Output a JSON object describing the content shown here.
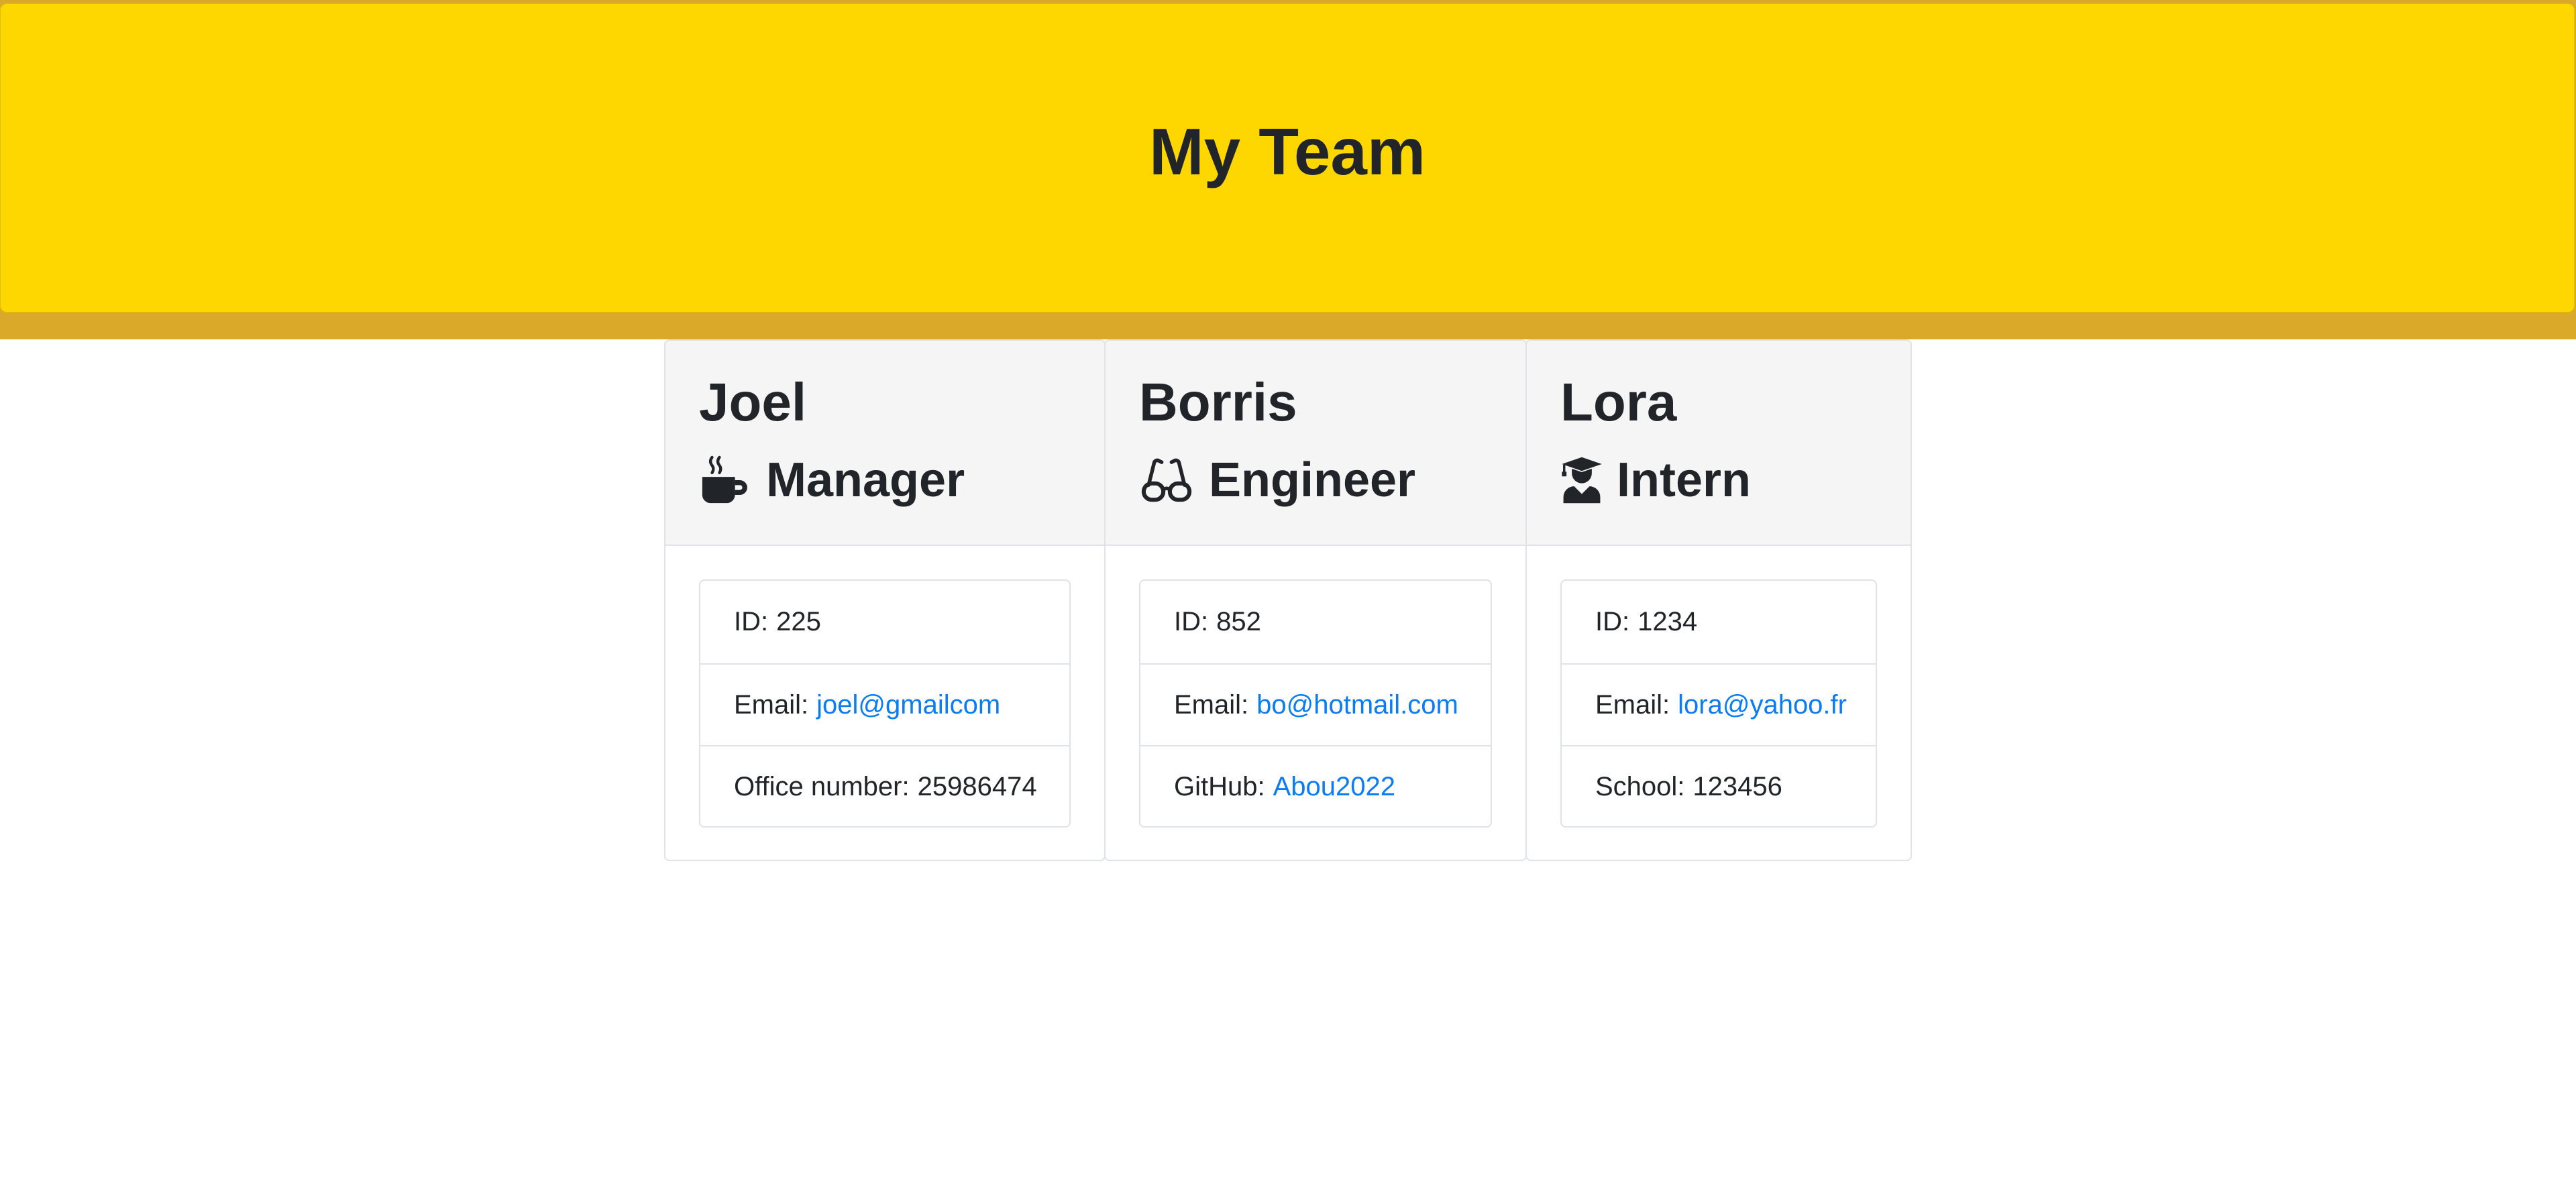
{
  "header": {
    "title": "My Team"
  },
  "colors": {
    "banner": "#ffd700",
    "banner_shadow": "#daa929",
    "card_header_bg": "#f5f5f5",
    "link": "#0a7cf5",
    "text": "#212529"
  },
  "employees": [
    {
      "name": "Joel",
      "role": "Manager",
      "role_icon": "coffee-mug-icon",
      "id_label": "ID:",
      "id": "225",
      "email_label": "Email:",
      "email": "joel@gmailcom",
      "extra_label": "Office number:",
      "extra_value": "25986474"
    },
    {
      "name": "Borris",
      "role": "Engineer",
      "role_icon": "glasses-icon",
      "id_label": "ID:",
      "id": "852",
      "email_label": "Email:",
      "email": "bo@hotmail.com",
      "extra_label": "GitHub:",
      "extra_value": "Abou2022"
    },
    {
      "name": "Lora",
      "role": "Intern",
      "role_icon": "graduate-user-icon",
      "id_label": "ID:",
      "id": "1234",
      "email_label": "Email:",
      "email": "lora@yahoo.fr",
      "extra_label": "School:",
      "extra_value": "123456"
    }
  ]
}
